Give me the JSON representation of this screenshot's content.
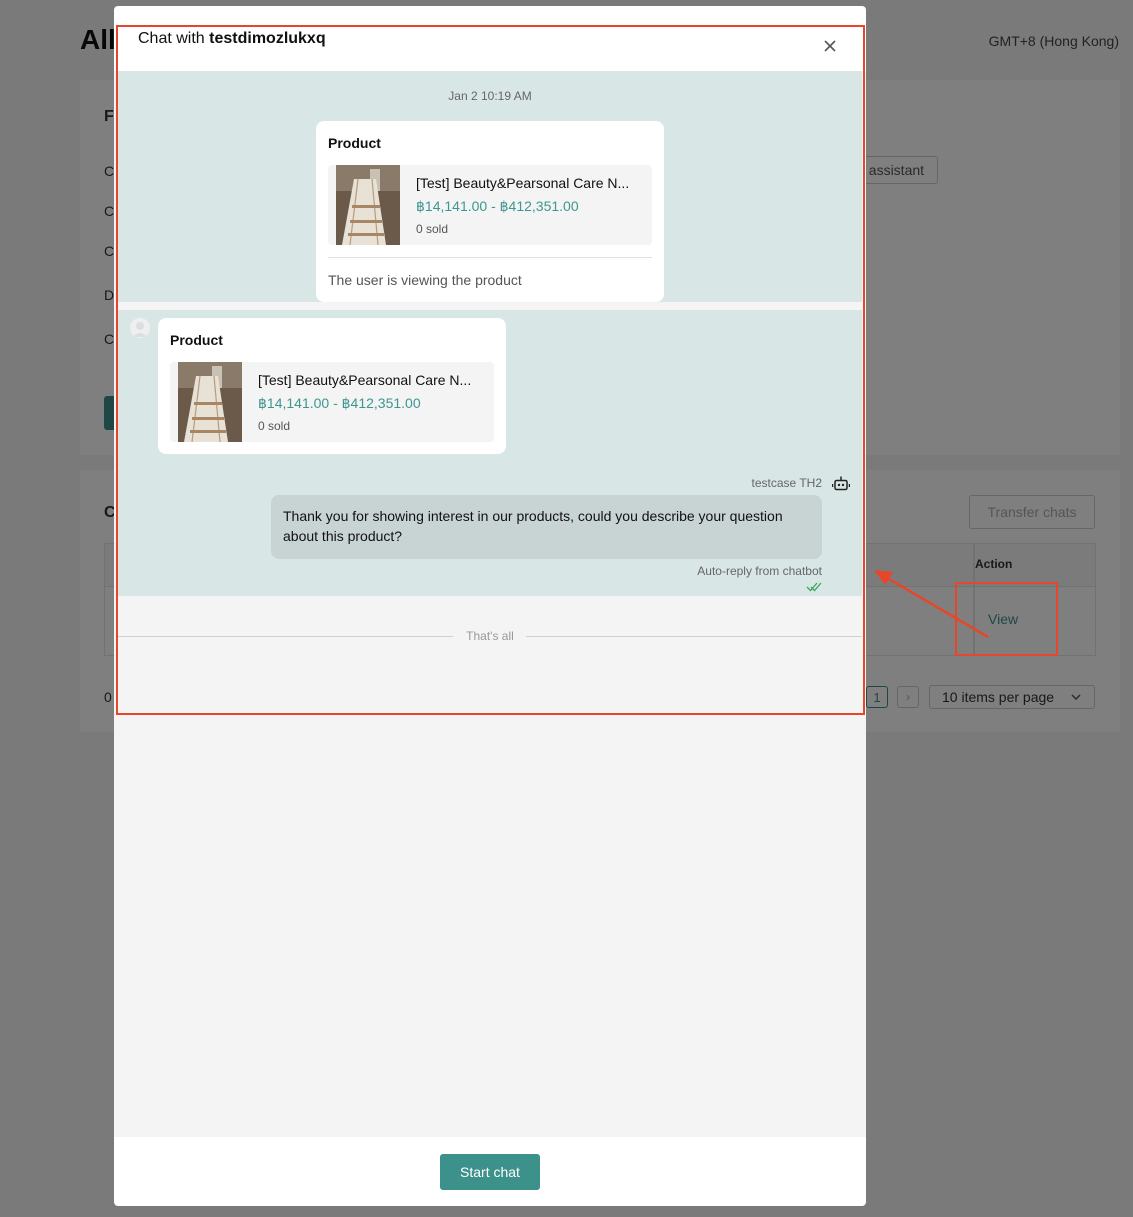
{
  "background": {
    "title": "All",
    "timezone": "GMT+8 (Hong Kong)",
    "form_letters": [
      "F",
      "C",
      "C",
      "C",
      "D",
      "C"
    ],
    "section_letter": "C",
    "pill_label": "t assistant",
    "transfer_label": "Transfer chats",
    "action_header": "Action",
    "view_label": "View",
    "total_prefix": "0",
    "page_number": "1",
    "per_page": "10 items per page"
  },
  "modal": {
    "title_prefix": "Chat with ",
    "username": "testdimozlukxq",
    "timestamp": "Jan 2 10:19 AM",
    "card1": {
      "header": "Product",
      "product_name": "[Test] Beauty&Pearsonal Care N...",
      "price": "฿14,141.00 - ฿412,351.00",
      "sold": "0 sold",
      "footer": "The user is viewing the product"
    },
    "card2": {
      "header": "Product",
      "product_name": "[Test] Beauty&Pearsonal Care N...",
      "price": "฿14,141.00 - ฿412,351.00",
      "sold": "0 sold"
    },
    "sender": "testcase TH2",
    "reply_text": "Thank you for showing interest in our products, could you describe your question about this product?",
    "reply_note": "Auto-reply from chatbot",
    "end_label": "That's all",
    "start_button": "Start chat"
  },
  "colors": {
    "accent": "#3d918b",
    "highlight": "#e8462a",
    "chat_bg": "#d8e6e5"
  }
}
